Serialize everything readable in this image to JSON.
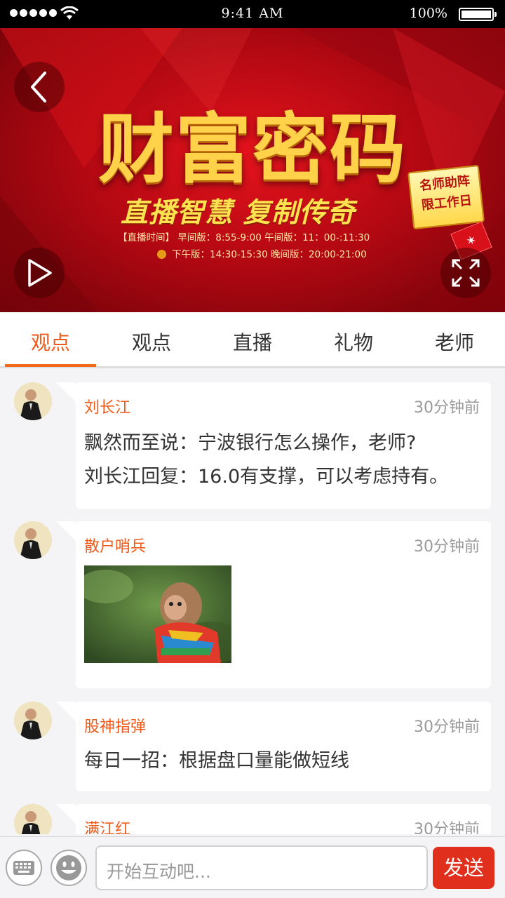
{
  "status_bar": {
    "time": "9:41 AM",
    "battery": "100%"
  },
  "banner": {
    "title": "财富密码",
    "subtitle": "直播智慧 复制传奇",
    "badge_line1": "名师助阵",
    "badge_line2": "限工作日",
    "schedule_row1": "【直播时间】 早间版：8:55-9:00 午间版：11：00-:11:30",
    "schedule_row2": "下午版：14:30-15:30 晚间版：20:00-21:00"
  },
  "tabs": [
    {
      "label": "观点",
      "active": true
    },
    {
      "label": "观点",
      "active": false
    },
    {
      "label": "直播",
      "active": false
    },
    {
      "label": "礼物",
      "active": false
    },
    {
      "label": "老师",
      "active": false
    }
  ],
  "feed": [
    {
      "author": "刘长江",
      "time": "30分钟前",
      "lines": [
        "飘然而至说：宁波银行怎么操作，老师?",
        "刘长江回复：16.0有支撑，可以考虑持有。"
      ]
    },
    {
      "author": "散户哨兵",
      "time": "30分钟前",
      "image": "monkey-photo"
    },
    {
      "author": "股神指弹",
      "time": "30分钟前",
      "lines": [
        "每日一招：根据盘口量能做短线"
      ]
    },
    {
      "author": "满江红",
      "time": "30分钟前"
    }
  ],
  "composer": {
    "placeholder": "开始互动吧...",
    "send_label": "发送"
  },
  "colors": {
    "accent": "#f05a1a",
    "send": "#e0301d",
    "banner": "#c80d16"
  }
}
